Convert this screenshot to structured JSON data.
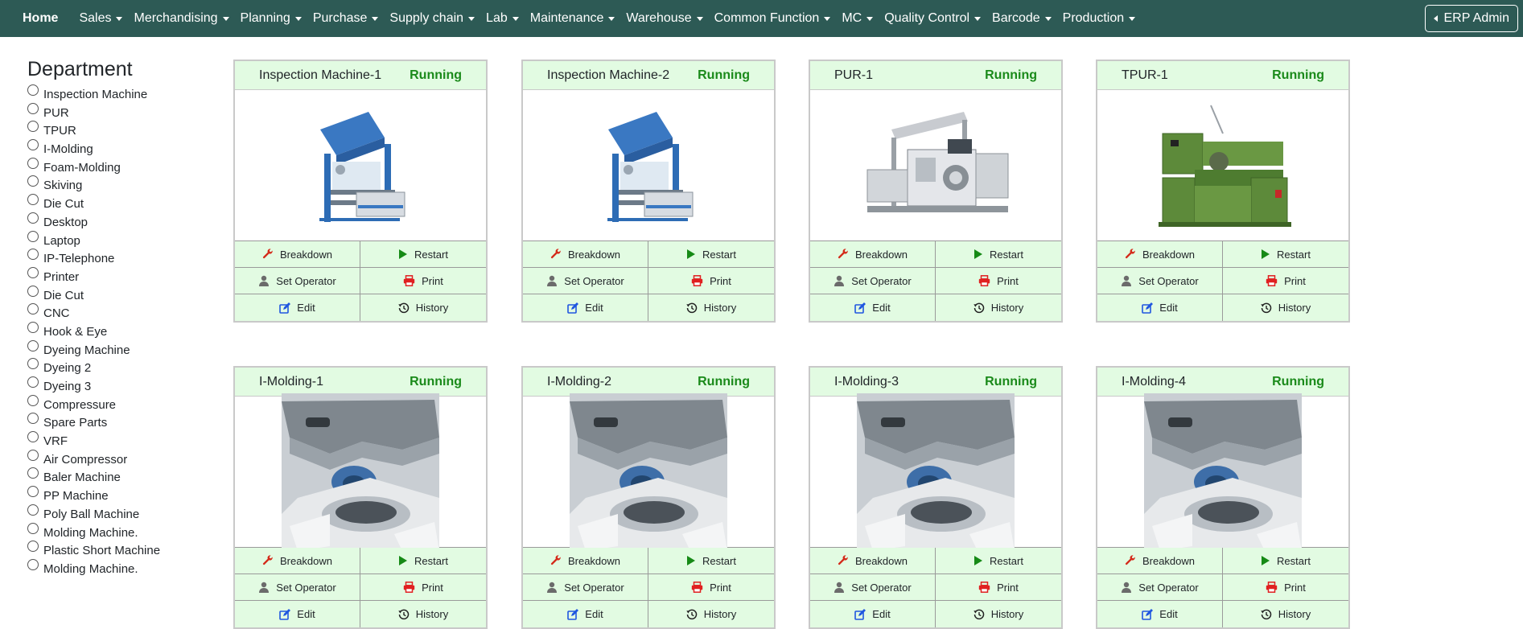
{
  "nav": {
    "home": "Home",
    "items": [
      "Sales",
      "Merchandising",
      "Planning",
      "Purchase",
      "Supply chain",
      "Lab",
      "Maintenance",
      "Warehouse",
      "Common Function",
      "MC",
      "Quality Control",
      "Barcode",
      "Production"
    ],
    "admin": "ERP Admin"
  },
  "sidebar": {
    "title": "Department",
    "items": [
      "Inspection Machine",
      "PUR",
      "TPUR",
      "I-Molding",
      "Foam-Molding",
      "Skiving",
      "Die Cut",
      "Desktop",
      "Laptop",
      "IP-Telephone",
      "Printer",
      "Die Cut",
      "CNC",
      "Hook & Eye",
      "Dyeing Machine",
      "Dyeing 2",
      "Dyeing 3",
      "Compressure",
      "Spare Parts",
      "VRF",
      "Air Compressor",
      "Baler Machine",
      "PP Machine",
      "Poly Ball Machine",
      "Molding Machine.",
      "Plastic Short Machine",
      "Molding Machine."
    ]
  },
  "actions": {
    "breakdown": "Breakdown",
    "restart": "Restart",
    "set_operator": "Set Operator",
    "print": "Print",
    "edit": "Edit",
    "history": "History"
  },
  "colors": {
    "navbar": "#2d5a55",
    "card_header": "#e2fbe2",
    "running": "#1a8a1a",
    "breakdown_icon": "#d42a1a",
    "restart_icon": "#168a16",
    "print_icon": "#e02020",
    "edit_icon": "#1f56e0"
  },
  "machines": [
    {
      "name": "Inspection Machine-1",
      "status": "Running",
      "image": "inspection-machine"
    },
    {
      "name": "Inspection Machine-2",
      "status": "Running",
      "image": "inspection-machine"
    },
    {
      "name": "PUR-1",
      "status": "Running",
      "image": "pur-machine"
    },
    {
      "name": "TPUR-1",
      "status": "Running",
      "image": "lathe-machine"
    },
    {
      "name": "I-Molding-1",
      "status": "Running",
      "image": "injection-mold"
    },
    {
      "name": "I-Molding-2",
      "status": "Running",
      "image": "injection-mold"
    },
    {
      "name": "I-Molding-3",
      "status": "Running",
      "image": "injection-mold"
    },
    {
      "name": "I-Molding-4",
      "status": "Running",
      "image": "injection-mold"
    }
  ]
}
